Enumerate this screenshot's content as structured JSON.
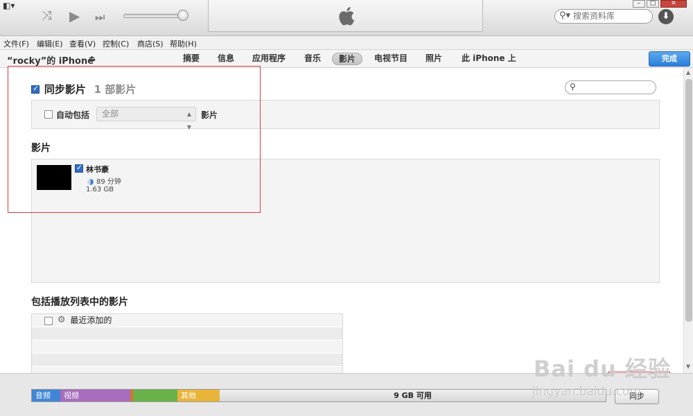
{
  "toolbar": {
    "system_menu": "◧▾",
    "shuffle_icon": "⤨",
    "play_icon": "▶",
    "next_icon": "⏭",
    "search_placeholder": "搜索资料库",
    "window_min": "–",
    "window_max": "□",
    "window_close": "✕"
  },
  "menubar": {
    "items": [
      "文件(F)",
      "编辑(E)",
      "查看(V)",
      "控制(C)",
      "商店(S)",
      "帮助(H)"
    ]
  },
  "device": {
    "name": "“rocky”的 iPhone",
    "eject_icon": "⏏",
    "tabs": [
      "摘要",
      "信息",
      "应用程序",
      "音乐",
      "影片",
      "电视节目",
      "照片",
      "此 iPhone 上"
    ],
    "active_tab": "影片",
    "done_label": "完成"
  },
  "content": {
    "sync_label": "同步影片",
    "sync_checked": true,
    "sync_count": "1 部影片",
    "auto_include_label": "自动包括",
    "auto_include_checked": false,
    "auto_include_value": "全部",
    "auto_include_suffix": "影片",
    "movies_heading": "影片",
    "movies": [
      {
        "title": "林书豪",
        "checked": true,
        "duration": "89 分钟",
        "size": "1.63 GB"
      }
    ],
    "playlists_heading": "包括播放列表中的影片",
    "playlists": [
      {
        "name": "最近添加的",
        "checked": false,
        "icon": "gear-icon"
      }
    ]
  },
  "capacity": {
    "segments": [
      {
        "label": "音频",
        "color": "#3f86d6"
      },
      {
        "label": "视频",
        "color": "#a86cbd"
      },
      {
        "label": "",
        "color": "#d6732e"
      },
      {
        "label": "",
        "color": "#69b24a"
      },
      {
        "label": "其他",
        "color": "#e9b43a"
      }
    ],
    "free_label": "9 GB 可用"
  },
  "sync_button": "同步",
  "watermark": {
    "logo": "Bai du 经验",
    "sub": "jingyan.baidu.com"
  },
  "colors": {
    "accent": "#2a7ed8",
    "annotation_red": "#e0383c"
  }
}
